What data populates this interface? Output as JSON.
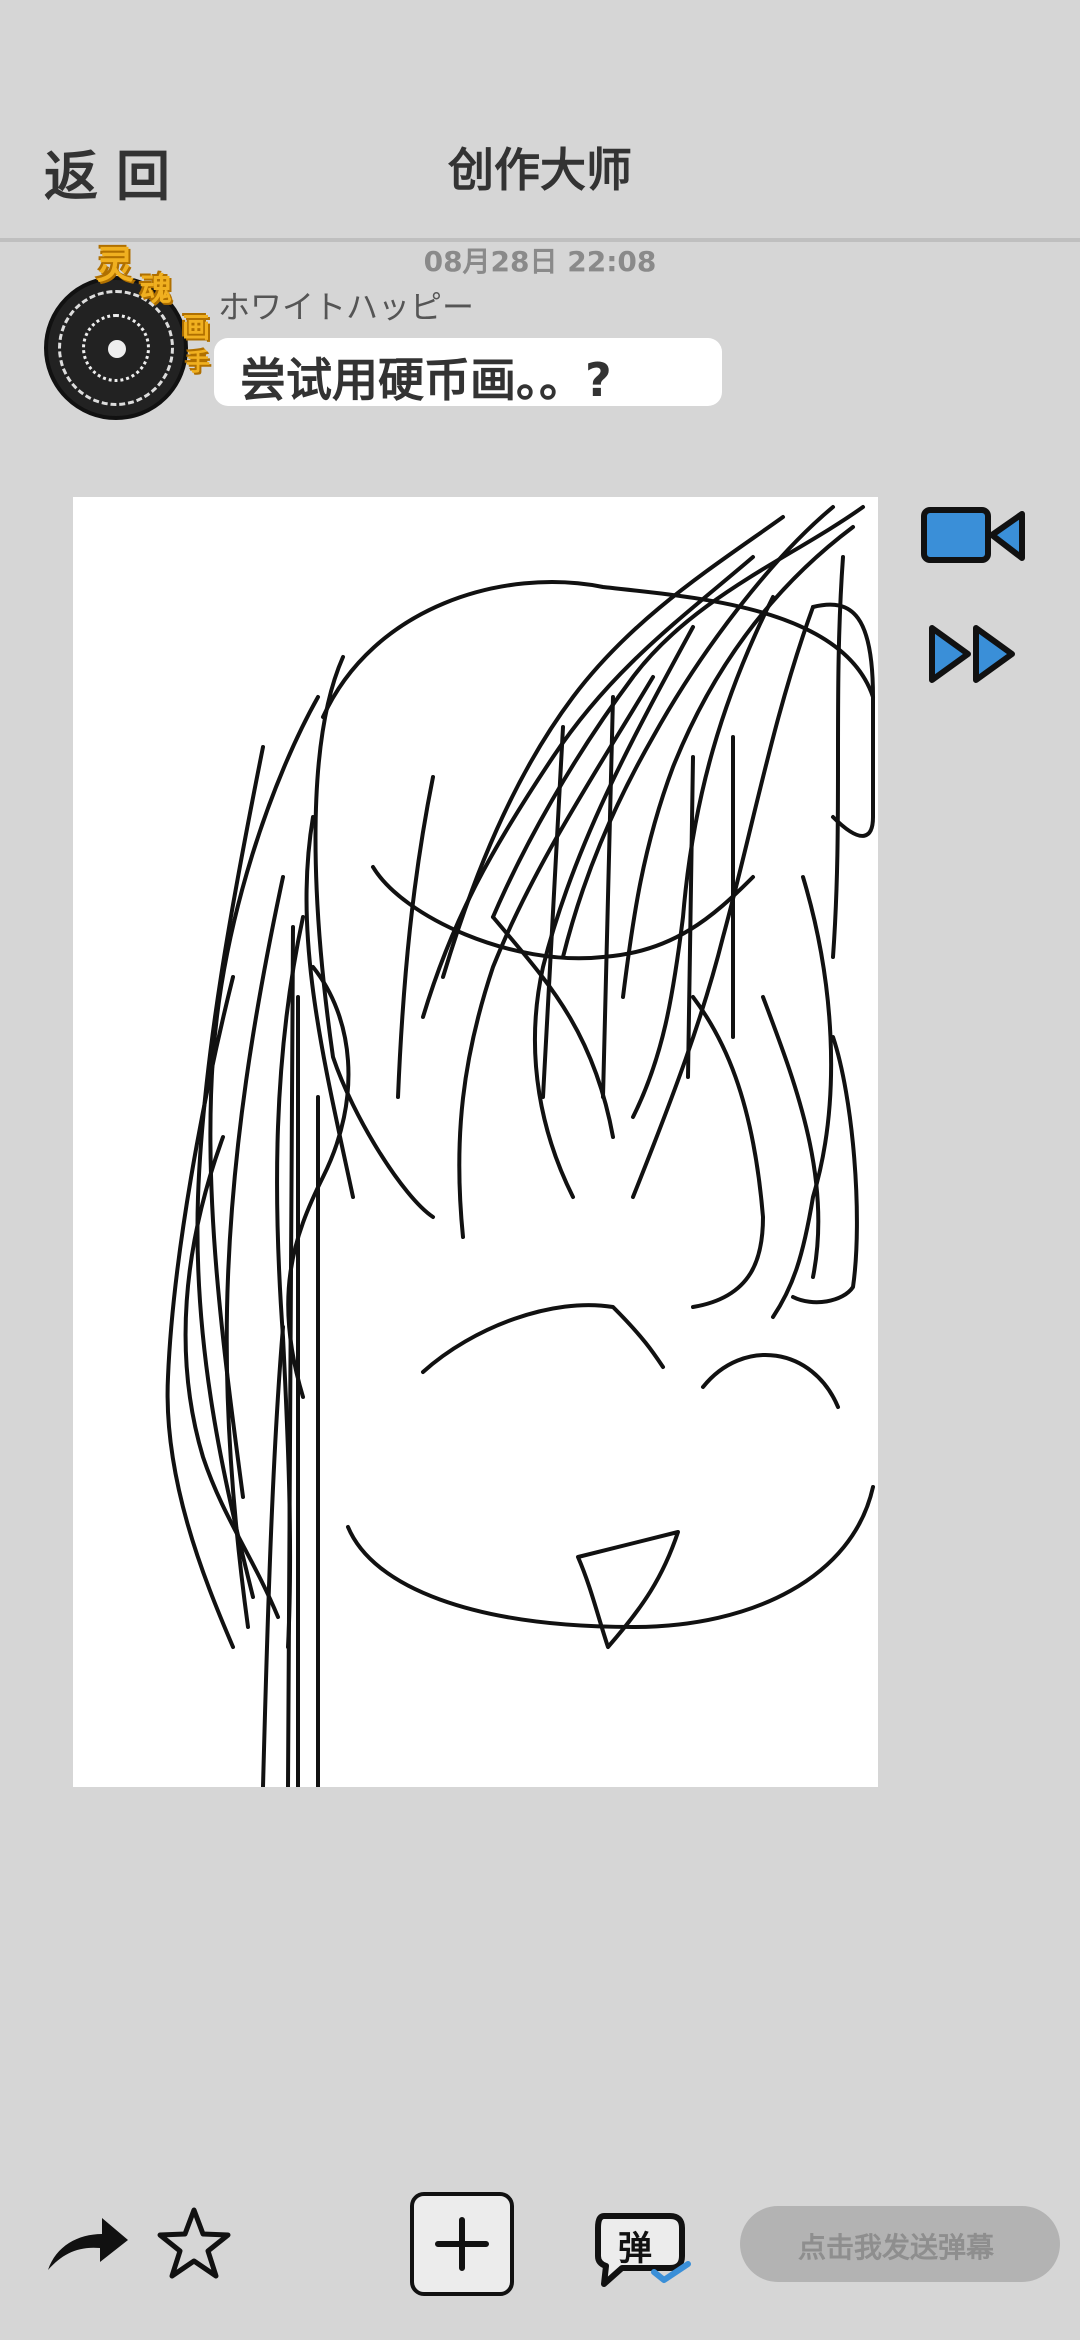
{
  "header": {
    "back_label": "返回",
    "title": "创作大师"
  },
  "post": {
    "timestamp": "08月28日  22:08",
    "username": "ホワイトハッピー",
    "message": "尝试用硬币画。。?",
    "avatar_badge": [
      "灵",
      "魂",
      "画",
      "手"
    ]
  },
  "side_controls": [
    "video-camera-icon",
    "fast-forward-icon"
  ],
  "bottom_bar": {
    "icons": [
      "share-arrow-icon",
      "star-icon",
      "plus-icon",
      "danmaku-icon"
    ],
    "danmaku_placeholder": "点击我发送弹幕"
  },
  "colors": {
    "background": "#d6d6d6",
    "accent_blue": "#3a8fd8",
    "input_bg": "#b3b3b3"
  }
}
